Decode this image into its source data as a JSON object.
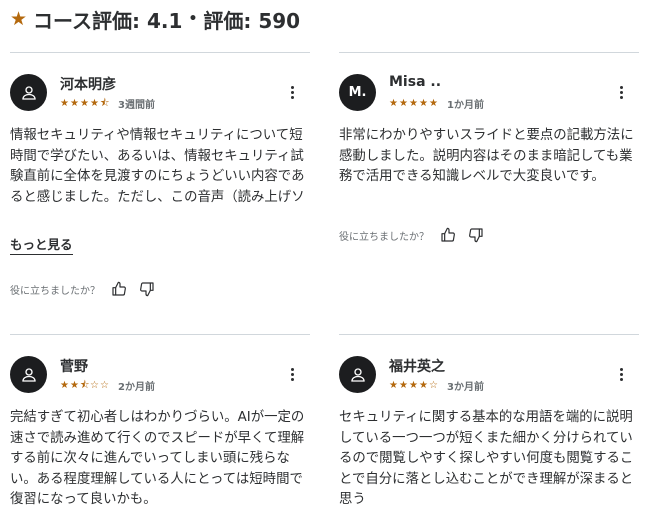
{
  "header": {
    "rating_label": "コース評価: 4.1",
    "count_label": "評価: 590"
  },
  "helpful_text": "役に立ちましたか？",
  "show_more_label": "もっと見る",
  "reviews": [
    {
      "name": "河本明彦",
      "avatar_initials": "",
      "rating": 4.5,
      "stars": [
        "★",
        "★",
        "★",
        "★",
        "⯪"
      ],
      "date": "3週間前",
      "body": "情報セキュリティや情報セキュリティについて短時間で学びたい、あるいは、情報セキュリティ試験直前に全体を見渡すのにちょうどいい内容であると感じました。ただし、この音声（読み上げソフト）は好き嫌いが分かれ…"
    },
    {
      "name": "Misa ..",
      "avatar_initials": "M.",
      "rating": 5,
      "stars": [
        "★",
        "★",
        "★",
        "★",
        "★"
      ],
      "date": "1か月前",
      "body": "非常にわかりやすいスライドと要点の記載方法に感動しました。説明内容はそのまま暗記しても業務で活用できる知識レベルで大変良いです。"
    },
    {
      "name": "菅野",
      "avatar_initials": "",
      "rating": 2.5,
      "stars": [
        "★",
        "★",
        "⯪",
        "☆",
        "☆"
      ],
      "date": "2か月前",
      "body": "完結すぎて初心者しはわかりづらい。AIが一定の速さで読み進めて行くのでスピードが早くて理解する前に次々に進んでいってしまい頭に残らない。ある程度理解している人にとっては短時間で復習になって良いかも。"
    },
    {
      "name": "福井英之",
      "avatar_initials": "",
      "rating": 4,
      "stars": [
        "★",
        "★",
        "★",
        "★",
        "☆"
      ],
      "date": "3か月前",
      "body": "セキュリティに関する基本的な用語を端的に説明している一つ一つが短くまた細かく分けられているので閲覧しやすく探しやすい何度も閲覧することで自分に落とし込むことができ理解が深まると思う"
    }
  ],
  "colors": {
    "star": "#b4690e",
    "avatar_bg": "#1c1d1f",
    "text": "#2d2f31",
    "muted": "#6a6f73"
  }
}
